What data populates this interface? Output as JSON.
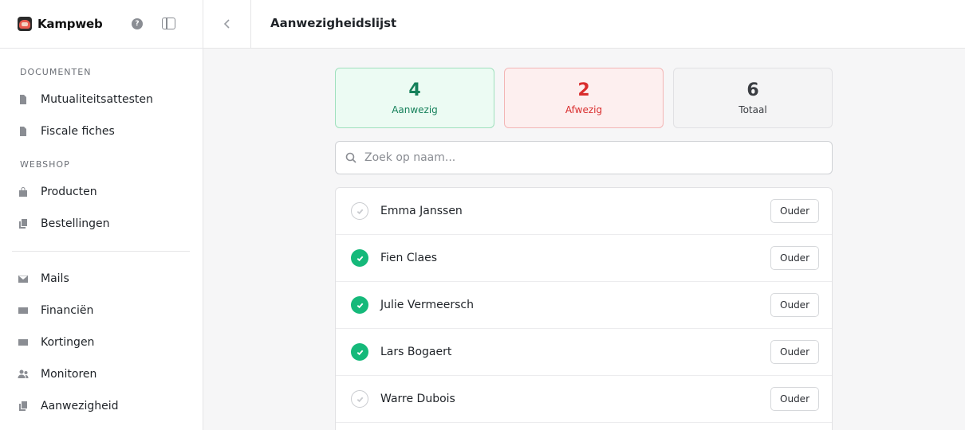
{
  "brand": {
    "name": "Kampweb"
  },
  "sidebar": {
    "sections": [
      {
        "label": "DOCUMENTEN"
      },
      {
        "label": "WEBSHOP"
      }
    ],
    "items": [
      {
        "label": "Mutualiteitsattesten",
        "icon": "document-icon"
      },
      {
        "label": "Fiscale fiches",
        "icon": "document-icon"
      },
      {
        "label": "Producten",
        "icon": "bag-icon"
      },
      {
        "label": "Bestellingen",
        "icon": "copy-icon"
      },
      {
        "label": "Mails",
        "icon": "mail-icon"
      },
      {
        "label": "Financiën",
        "icon": "money-icon"
      },
      {
        "label": "Kortingen",
        "icon": "money-icon"
      },
      {
        "label": "Monitoren",
        "icon": "users-icon"
      },
      {
        "label": "Aanwezigheid",
        "icon": "copy-icon"
      }
    ]
  },
  "header": {
    "title": "Aanwezigheidslijst"
  },
  "stats": {
    "present": {
      "value": "4",
      "label": "Aanwezig",
      "color": "#15805a"
    },
    "absent": {
      "value": "2",
      "label": "Afwezig",
      "color": "#d92d2d"
    },
    "total": {
      "value": "6",
      "label": "Totaal"
    }
  },
  "search": {
    "placeholder": "Zoek op naam...",
    "value": ""
  },
  "attendees": [
    {
      "name": "Emma Janssen",
      "present": false,
      "button": "Ouder"
    },
    {
      "name": "Fien Claes",
      "present": true,
      "button": "Ouder"
    },
    {
      "name": "Julie Vermeersch",
      "present": true,
      "button": "Ouder"
    },
    {
      "name": "Lars Bogaert",
      "present": true,
      "button": "Ouder"
    },
    {
      "name": "Warre Dubois",
      "present": false,
      "button": "Ouder"
    }
  ]
}
